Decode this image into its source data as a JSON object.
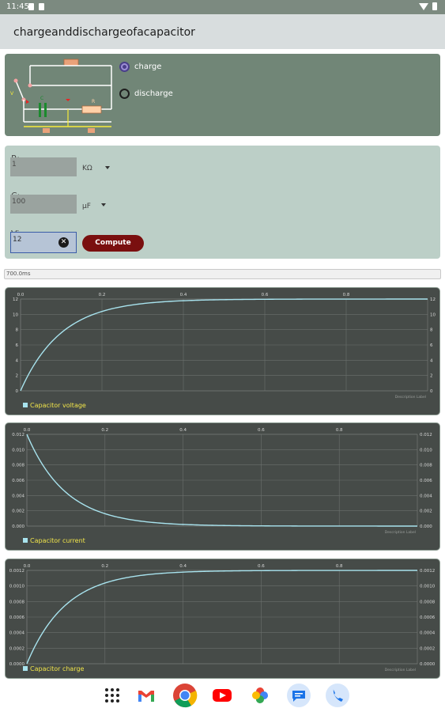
{
  "status_bar": {
    "time": "11:45"
  },
  "app": {
    "title": "chargeanddischargeofacapacitor"
  },
  "mode": {
    "options": [
      "charge",
      "discharge"
    ],
    "selected": "charge"
  },
  "inputs": {
    "r": {
      "label": "R:",
      "value": "1",
      "unit": "KΩ"
    },
    "c": {
      "label": "C:",
      "value": "100",
      "unit": "μF"
    },
    "vin": {
      "label": "Vin:",
      "value": "12"
    },
    "compute_label": "Compute"
  },
  "time_display": "700.0ms",
  "colors": {
    "accent_line": "#a8e3ee",
    "legend_text": "#f0e44a",
    "panel_bg": "#464b48",
    "button": "#7a0f0f"
  },
  "chart_data": [
    {
      "type": "line",
      "x_ticks": [
        "0.0",
        "0.2",
        "0.4",
        "0.6",
        "0.8"
      ],
      "xlim": [
        0,
        1
      ],
      "ylim": [
        0,
        12
      ],
      "y_ticks_left": [
        "0",
        "2",
        "4",
        "6",
        "8",
        "10",
        "12"
      ],
      "y_ticks_right": [
        "0",
        "2",
        "4",
        "6",
        "8",
        "10",
        "12"
      ],
      "series": [
        {
          "name": "Capacitor voltage",
          "kind": "rise",
          "amplitude": 12,
          "tau": 0.1
        }
      ],
      "description_label": "Description Label",
      "grid": true,
      "legend": "bottom-left"
    },
    {
      "type": "line",
      "x_ticks": [
        "0.0",
        "0.2",
        "0.4",
        "0.6",
        "0.8"
      ],
      "xlim": [
        0,
        1
      ],
      "ylim": [
        0,
        0.012
      ],
      "y_ticks_left": [
        "0.000",
        "0.002",
        "0.004",
        "0.006",
        "0.008",
        "0.010",
        "0.012"
      ],
      "y_ticks_right": [
        "0.000",
        "0.002",
        "0.004",
        "0.006",
        "0.008",
        "0.010",
        "0.012"
      ],
      "series": [
        {
          "name": "Capacitor current",
          "kind": "decay",
          "amplitude": 0.012,
          "tau": 0.1
        }
      ],
      "description_label": "Description Label",
      "grid": true,
      "legend": "bottom-left"
    },
    {
      "type": "line",
      "x_ticks": [
        "0.0",
        "0.2",
        "0.4",
        "0.6",
        "0.8"
      ],
      "xlim": [
        0,
        1
      ],
      "ylim": [
        0,
        0.0012
      ],
      "y_ticks_left": [
        "0.0000",
        "0.0002",
        "0.0004",
        "0.0006",
        "0.0008",
        "0.0010",
        "0.0012"
      ],
      "y_ticks_right": [
        "0.0000",
        "0.0002",
        "0.0004",
        "0.0006",
        "0.0008",
        "0.0010",
        "0.0012"
      ],
      "series": [
        {
          "name": "Capacitor charge",
          "kind": "rise",
          "amplitude": 0.0012,
          "tau": 0.1
        }
      ],
      "description_label": "Description Label",
      "grid": true,
      "legend": "bottom-left"
    }
  ],
  "nav_apps": [
    "app-drawer",
    "gmail",
    "chrome",
    "youtube",
    "photos",
    "messages",
    "phone"
  ]
}
